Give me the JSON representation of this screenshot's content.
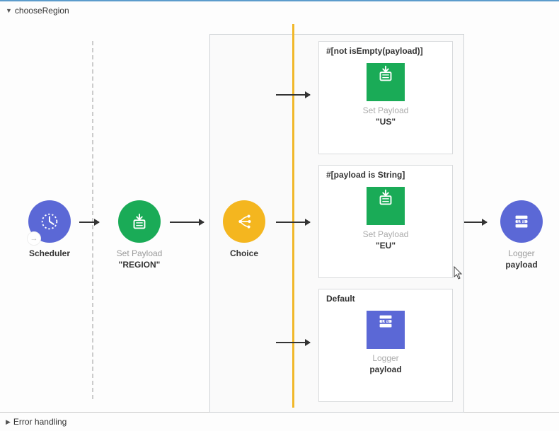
{
  "header": {
    "title": "chooseRegion"
  },
  "footer": {
    "title": "Error handling"
  },
  "nodes": {
    "scheduler": {
      "label1": "Scheduler"
    },
    "setPayloadRegion": {
      "label1": "Set Payload",
      "label2": "\"REGION\""
    },
    "choice": {
      "label1": "Choice"
    },
    "logger": {
      "label1": "Logger",
      "label2": "payload"
    }
  },
  "branches": {
    "b1": {
      "header": "#[not isEmpty(payload)]",
      "label1": "Set Payload",
      "label2": "\"US\""
    },
    "b2": {
      "header": "#[payload is String]",
      "label1": "Set Payload",
      "label2": "\"EU\""
    },
    "b3": {
      "header": "Default",
      "label1": "Logger",
      "label2": "payload"
    }
  }
}
